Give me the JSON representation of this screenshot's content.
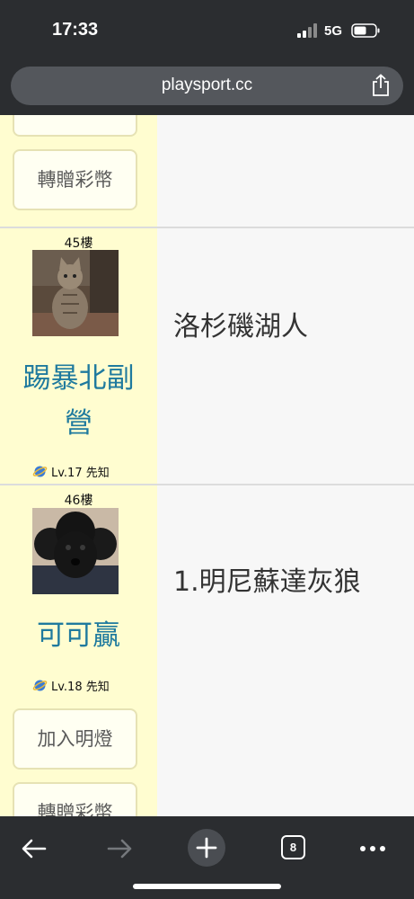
{
  "status_bar": {
    "time": "17:33",
    "network": "5G"
  },
  "browser": {
    "url": "playsport.cc",
    "tab_count": "8"
  },
  "posts": [
    {
      "button": "轉贈彩幣"
    },
    {
      "floor": "45樓",
      "username_line1": "踢暴北副",
      "username_line2": "營",
      "level": "Lv.17 先知",
      "content": "洛杉磯湖人"
    },
    {
      "floor": "46樓",
      "username": "可可贏",
      "level": "Lv.18 先知",
      "content": "1.明尼蘇達灰狼",
      "button_light": "加入明燈",
      "button_gift": "轉贈彩幣"
    }
  ],
  "colors": {
    "sidebar_bg": "#fffdd0",
    "username": "#1f7a9e",
    "chrome": "#2b2d30"
  }
}
